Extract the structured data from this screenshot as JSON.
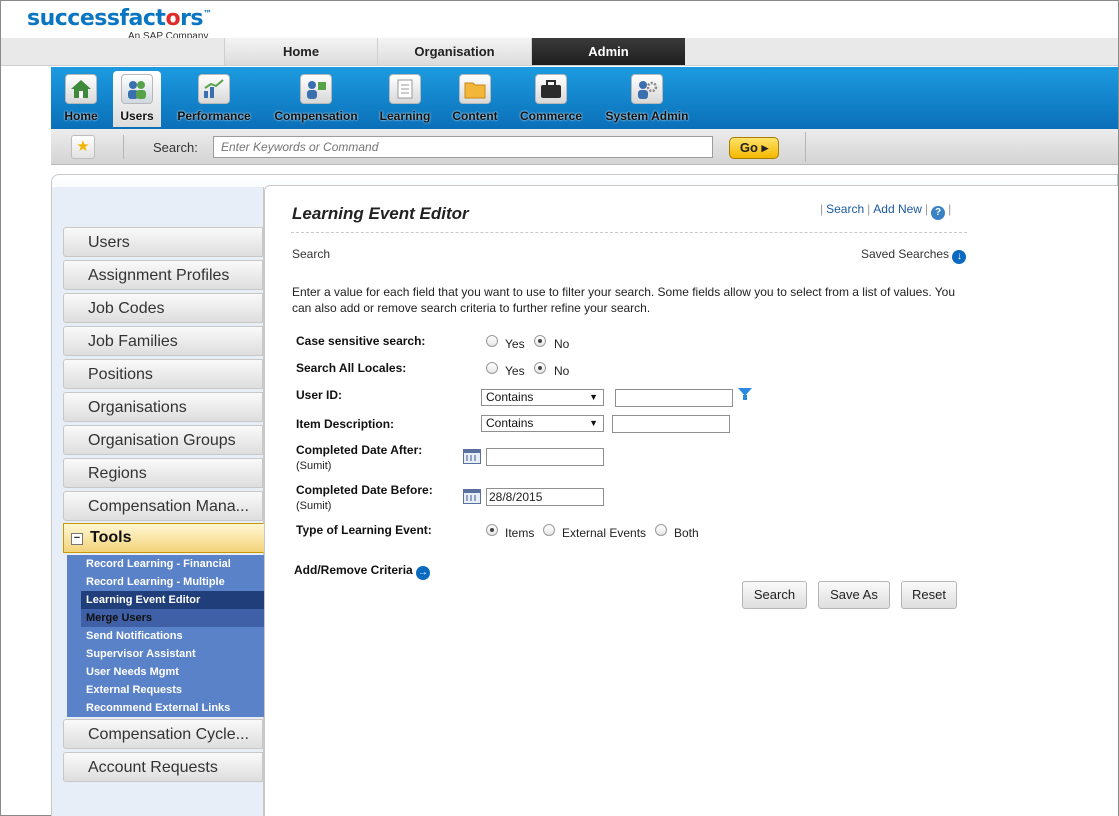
{
  "brand": {
    "logo_a": "success",
    "logo_b": "fact",
    "logo_heart": "o",
    "logo_c": "rs",
    "tm": "™",
    "sub": "An SAP Company"
  },
  "top_tabs": [
    {
      "label": "Home"
    },
    {
      "label": "Organisation"
    },
    {
      "label": "Admin",
      "active": true
    }
  ],
  "nav": [
    {
      "label": "Home",
      "icon": "home-icon"
    },
    {
      "label": "Users",
      "icon": "users-icon",
      "active": true
    },
    {
      "label": "Performance",
      "icon": "performance-chart-icon"
    },
    {
      "label": "Compensation",
      "icon": "compensation-icon"
    },
    {
      "label": "Learning",
      "icon": "learning-document-icon"
    },
    {
      "label": "Content",
      "icon": "content-folder-icon"
    },
    {
      "label": "Commerce",
      "icon": "commerce-briefcase-icon"
    },
    {
      "label": "System Admin",
      "icon": "system-admin-gear-icon"
    }
  ],
  "searchbar": {
    "star": "★",
    "label": "Search:",
    "placeholder": "Enter Keywords or Command",
    "go": "Go"
  },
  "sidebar": {
    "items_top": [
      "Users",
      "Assignment Profiles",
      "Job Codes",
      "Job Families",
      "Positions",
      "Organisations",
      "Organisation Groups",
      "Regions",
      "Compensation Mana..."
    ],
    "tools": {
      "label": "Tools",
      "toggle": "−"
    },
    "tools_items": [
      "Record Learning - Financial",
      "Record Learning - Multiple",
      "Learning Event Editor",
      "Merge Users",
      "Send Notifications",
      "Supervisor Assistant",
      "User Needs Mgmt",
      "External Requests",
      "Recommend External Links"
    ],
    "items_bottom": [
      "Compensation Cycle...",
      "Account Requests"
    ]
  },
  "page": {
    "title": "Learning Event Editor",
    "links": {
      "search": "Search",
      "add_new": "Add New",
      "sep": "|",
      "help": "?"
    },
    "section": "Search",
    "saved_searches": "Saved Searches",
    "saved_icon": "↓",
    "intro": "Enter a value for each field that you want to use to filter your search. Some fields allow you to select from a list of values. You can also add or remove search criteria to further refine your search."
  },
  "form": {
    "case_sensitive": {
      "label": "Case sensitive search:",
      "yes": "Yes",
      "no": "No",
      "selected": "No"
    },
    "all_locales": {
      "label": "Search All Locales:",
      "yes": "Yes",
      "no": "No",
      "selected": "No"
    },
    "user_id": {
      "label": "User ID:",
      "operator": "Contains",
      "value": ""
    },
    "item_description": {
      "label": "Item Description:",
      "operator": "Contains",
      "value": ""
    },
    "completed_after": {
      "label": "Completed Date After:",
      "sub": "(Sumit)",
      "value": ""
    },
    "completed_before": {
      "label": "Completed Date Before:",
      "sub": "(Sumit)",
      "value": "28/8/2015"
    },
    "event_type": {
      "label": "Type of Learning Event:",
      "items": "Items",
      "external": "External Events",
      "both": "Both",
      "selected": "Items"
    },
    "add_remove": "Add/Remove Criteria",
    "add_remove_icon": "→",
    "arrow": "▼",
    "buttons": {
      "search": "Search",
      "save_as": "Save As",
      "reset": "Reset"
    }
  }
}
